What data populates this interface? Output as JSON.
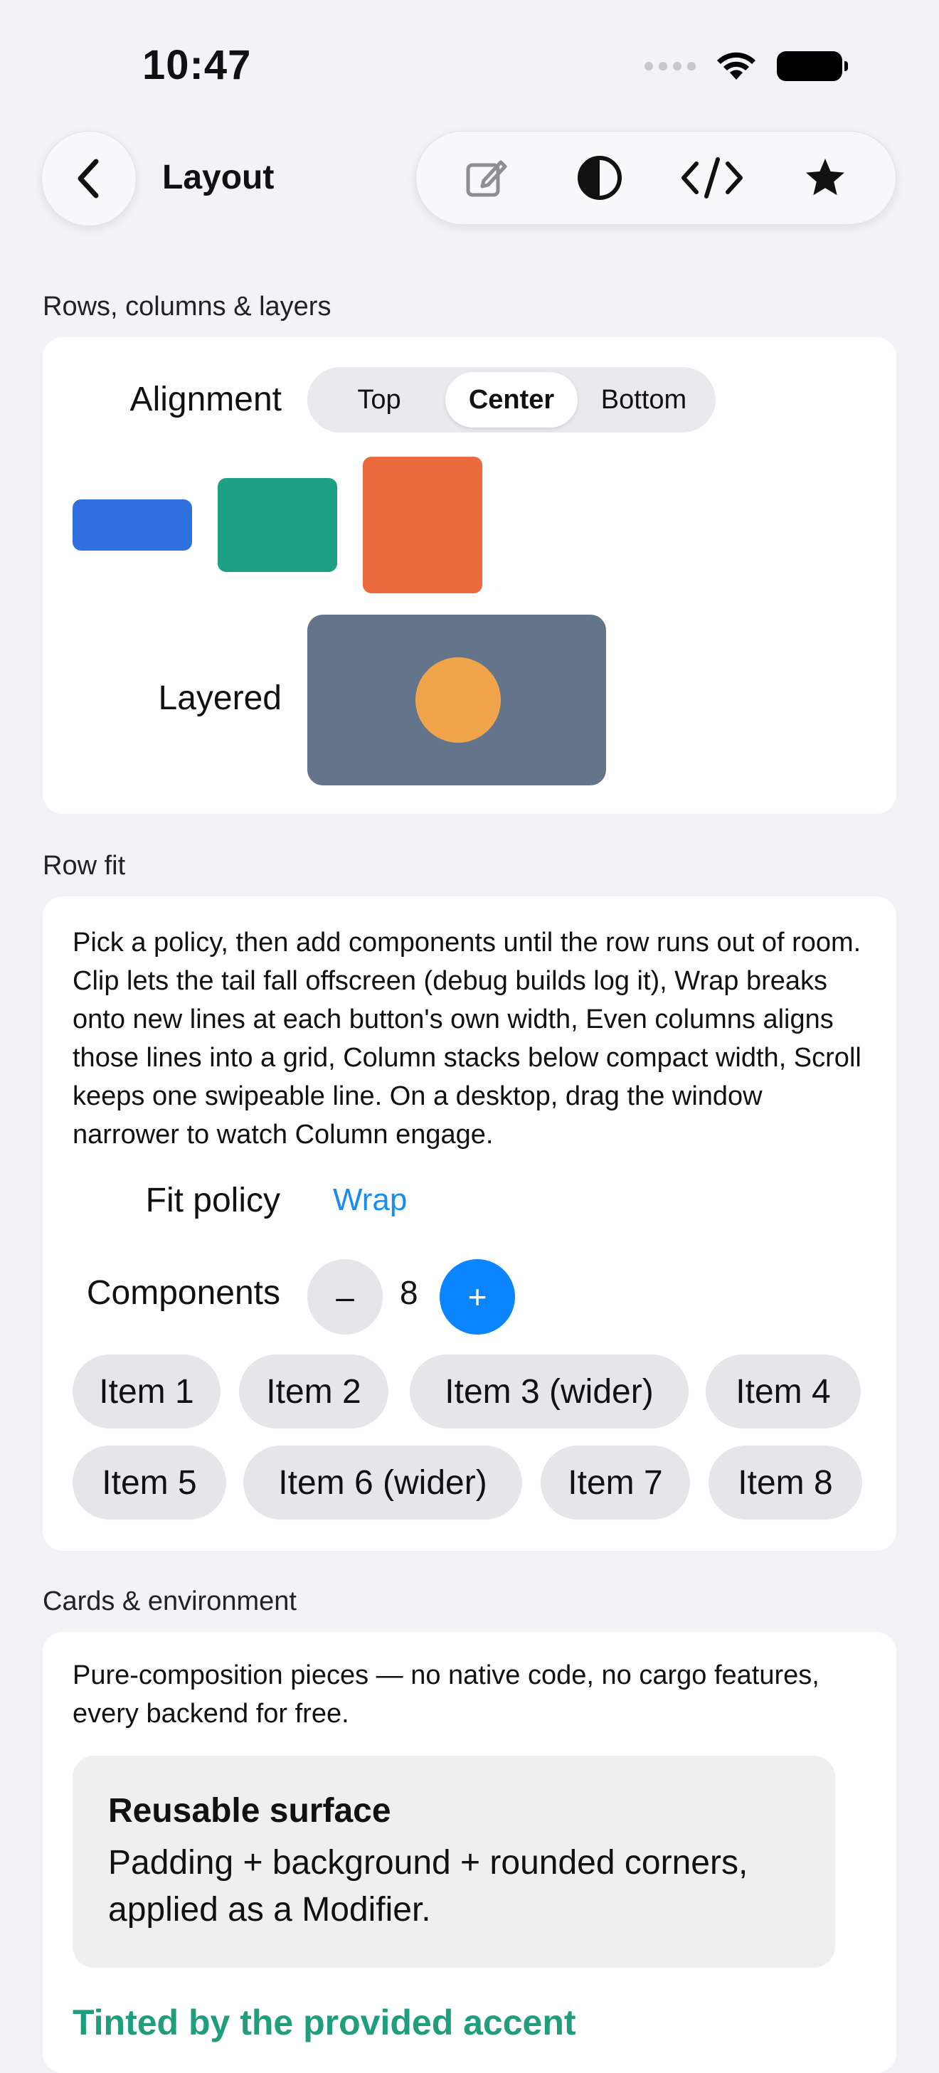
{
  "status_bar": {
    "time": "10:47",
    "icons": [
      "signal-dots-icon",
      "wifi-icon",
      "battery-icon"
    ]
  },
  "nav": {
    "back_icon": "chevron-left-icon",
    "title": "Layout",
    "toolbar_icons": [
      "edit-icon",
      "contrast-icon",
      "code-icon",
      "star-icon"
    ]
  },
  "sections": {
    "rows": {
      "label": "Rows, columns & layers",
      "alignment_label": "Alignment",
      "segments": [
        "Top",
        "Center",
        "Bottom"
      ],
      "selected_segment": "Center",
      "layered_label": "Layered",
      "colors": {
        "blue": "#2f6fde",
        "green": "#1ea085",
        "orange": "#ea6a3e",
        "slate": "#64748b",
        "circle": "#f0a54c"
      }
    },
    "row_fit": {
      "label": "Row fit",
      "description": "Pick a policy, then add components until the row runs out of room. Clip lets the tail fall offscreen (debug builds log it), Wrap breaks onto new lines at each button's own width, Even columns aligns those lines into a grid, Column stacks below compact width, Scroll keeps one swipeable line. On a desktop, drag the window narrower to watch Column engage.",
      "fit_policy_label": "Fit policy",
      "fit_policy_value": "Wrap",
      "components_label": "Components",
      "minus": "–",
      "count": "8",
      "plus": "+",
      "items": [
        "Item 1",
        "Item 2",
        "Item 3 (wider)",
        "Item 4",
        "Item 5",
        "Item 6 (wider)",
        "Item 7",
        "Item 8"
      ]
    },
    "cards": {
      "label": "Cards & environment",
      "description": "Pure-composition pieces — no native code, no cargo features, every backend for free.",
      "surface_title": "Reusable surface",
      "surface_body": "Padding + background + rounded corners, applied as a Modifier.",
      "accent_text": "Tinted by the provided accent",
      "accent_color": "#1f9e7e"
    }
  }
}
